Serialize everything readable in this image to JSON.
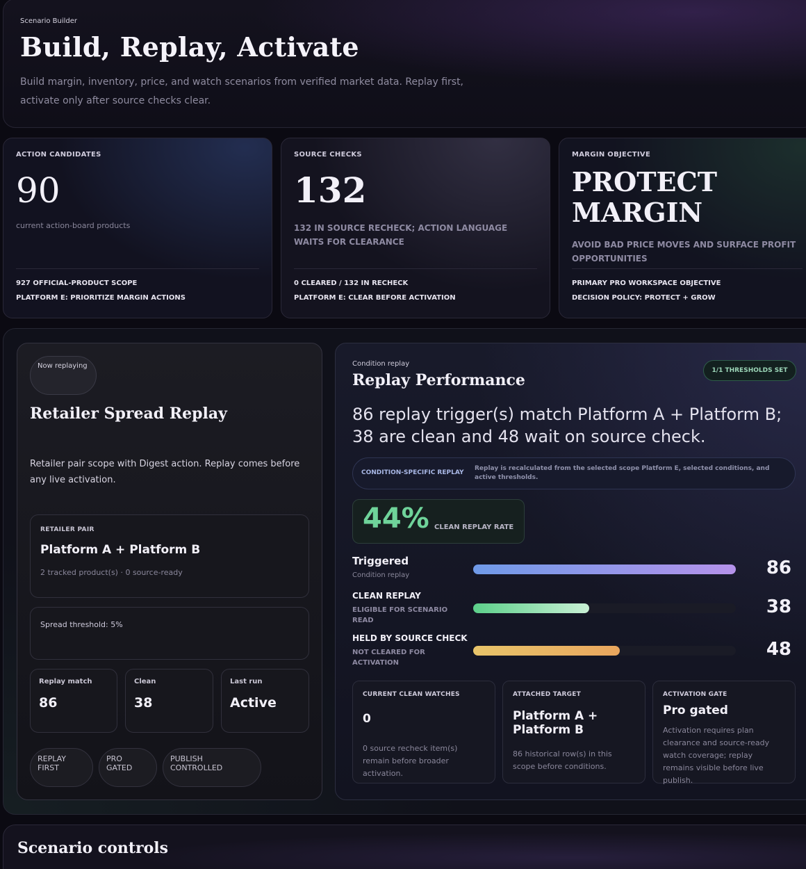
{
  "header": {
    "eyebrow": "Scenario Builder",
    "title": "Build, Replay, Activate",
    "description": "Build margin, inventory, price, and watch scenarios from verified market data. Replay first, activate only after source checks clear."
  },
  "stats": [
    {
      "label": "ACTION CANDIDATES",
      "value": "90",
      "sub": "current action-board products",
      "foot": [
        "927 OFFICIAL-PRODUCT SCOPE",
        "PLATFORM E: PRIORITIZE MARGIN ACTIONS"
      ]
    },
    {
      "label": "SOURCE CHECKS",
      "value": "132",
      "sub": "132 IN SOURCE RECHECK; ACTION LANGUAGE WAITS FOR CLEARANCE",
      "foot": [
        "0 CLEARED / 132 IN RECHECK",
        "PLATFORM E: CLEAR BEFORE ACTIVATION"
      ]
    },
    {
      "label": "MARGIN OBJECTIVE",
      "value": "PROTECT MARGIN",
      "sub": "AVOID BAD PRICE MOVES AND SURFACE PROFIT OPPORTUNITIES",
      "foot": [
        "PRIMARY PRO WORKSPACE OBJECTIVE",
        "DECISION POLICY: PROTECT + GROW"
      ]
    }
  ],
  "left_panel": {
    "status_pill": "Now replaying",
    "title": "Retailer Spread Replay",
    "description": "Retailer pair scope with Digest action. Replay comes before any live activation.",
    "retailer_pair": {
      "label": "RETAILER PAIR",
      "value": "Platform A + Platform B",
      "meta": "2 tracked product(s) · 0 source-ready"
    },
    "threshold": "Spread threshold: 5%",
    "minis": [
      {
        "label": "Replay match",
        "value": "86"
      },
      {
        "label": "Clean",
        "value": "38"
      },
      {
        "label": "Last run",
        "value": "Active"
      }
    ],
    "tags": [
      "REPLAY FIRST",
      "PRO GATED",
      "PUBLISH CONTROLLED"
    ]
  },
  "right_panel": {
    "eyebrow": "Condition replay",
    "title": "Replay Performance",
    "badge": "1/1 THRESHOLDS SET",
    "lead": "86 replay trigger(s) match Platform A + Platform B; 38 are clean and 48 wait on source check.",
    "strip": {
      "key": "CONDITION-SPECIFIC REPLAY",
      "text": "Replay is recalculated from the selected scope Platform E, selected conditions, and active thresholds."
    },
    "rate": {
      "value": "44%",
      "label": "CLEAN REPLAY RATE"
    },
    "bars": [
      {
        "name": "Triggered",
        "sub": "Condition replay",
        "value": 86,
        "count": "86",
        "max": 86,
        "color_from": "#6f9ae8",
        "color_to": "#b592ea"
      },
      {
        "name": "CLEAN REPLAY",
        "sub": "ELIGIBLE FOR SCENARIO READ",
        "value": 38,
        "count": "38",
        "max": 86,
        "color_from": "#5ccf8a",
        "color_to": "#c9f0d5"
      },
      {
        "name": "HELD BY SOURCE CHECK",
        "sub": "NOT CLEARED FOR ACTIVATION",
        "value": 48,
        "count": "48",
        "max": 86,
        "color_from": "#e8c46a",
        "color_to": "#e9a65e"
      }
    ],
    "cards": [
      {
        "label": "CURRENT CLEAN WATCHES",
        "value": "0",
        "desc": "0 source recheck item(s) remain before broader activation."
      },
      {
        "label": "ATTACHED TARGET",
        "value": "Platform A + Platform B",
        "desc": "86 historical row(s) in this scope before conditions."
      },
      {
        "label": "ACTIVATION GATE",
        "value": "Pro gated",
        "desc": "Activation requires plan clearance and source-ready watch coverage; replay remains visible before live publish."
      }
    ]
  },
  "controls": {
    "title": "Scenario controls"
  }
}
